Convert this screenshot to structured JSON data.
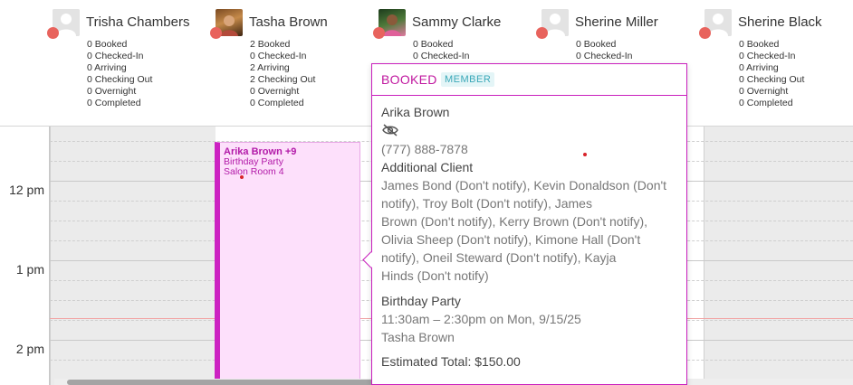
{
  "staff": [
    {
      "name": "Trisha Chambers",
      "avatar": "placeholder",
      "stats": [
        "0 Booked",
        "0 Checked-In",
        "0 Arriving",
        "0 Checking Out",
        "0 Overnight",
        "0 Completed"
      ]
    },
    {
      "name": "Tasha Brown",
      "avatar": "photo",
      "stats": [
        "2 Booked",
        "0 Checked-In",
        "2 Arriving",
        "2 Checking Out",
        "0 Overnight",
        "0 Completed"
      ]
    },
    {
      "name": "Sammy Clarke",
      "avatar": "photo",
      "stats": [
        "0 Booked",
        "0 Checked-In"
      ]
    },
    {
      "name": "Sherine Miller",
      "avatar": "placeholder",
      "stats": [
        "0 Booked",
        "0 Checked-In"
      ]
    },
    {
      "name": "Sherine Black",
      "avatar": "placeholder",
      "stats": [
        "0 Booked",
        "0 Checked-In",
        "0 Arriving",
        "0 Checking Out",
        "0 Overnight",
        "0 Completed"
      ]
    }
  ],
  "times": [
    "12 pm",
    "1 pm",
    "2 pm"
  ],
  "appointment": {
    "title": "Arika Brown +9",
    "service": "Birthday Party",
    "room": "Salon Room 4"
  },
  "popover": {
    "status": "BOOKED",
    "badge": "MEMBER",
    "client_name": "Arika Brown",
    "hidden_icon": "eye-slash-icon",
    "phone": "(777) 888-7878",
    "additional_label": "Additional Client",
    "additional_clients_lines": [
      "James Bond (Don't notify), Kevin Donaldson (Don't",
      "notify), Troy Bolt (Don't notify), James",
      "Brown (Don't notify), Kerry Brown (Don't notify),",
      "Olivia Sheep (Don't notify), Kimone Hall (Don't",
      "notify), Oneil Steward (Don't notify), Kayja",
      "Hinds (Don't notify)"
    ],
    "service": "Birthday Party",
    "time": "11:30am – 2:30pm on Mon, 9/15/25",
    "staff": "Tasha Brown",
    "estimated_total": "Estimated Total: $150.00"
  },
  "colors": {
    "booked": "#c0179f",
    "appointment_bg": "#fde0fb",
    "appointment_border": "#cc22c2",
    "status_dot": "#e8635d",
    "member_badge": "#3aa8b8"
  }
}
